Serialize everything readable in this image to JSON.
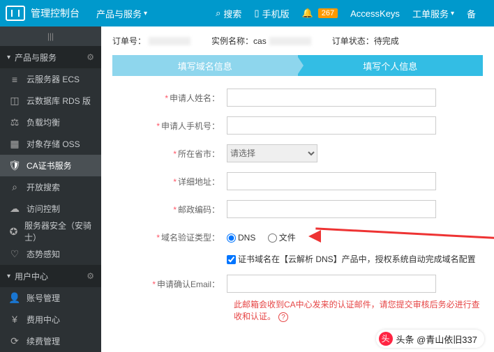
{
  "topbar": {
    "console": "管理控制台",
    "products": "产品与服务",
    "search": "搜索",
    "mobile": "手机版",
    "notif_count": "267",
    "access_keys": "AccessKeys",
    "ticket": "工单服务",
    "backup": "备"
  },
  "sidebar": {
    "section1": "产品与服务",
    "items1": [
      {
        "label": "云服务器 ECS"
      },
      {
        "label": "云数据库 RDS 版"
      },
      {
        "label": "负载均衡"
      },
      {
        "label": "对象存储 OSS"
      },
      {
        "label": "CA证书服务"
      },
      {
        "label": "开放搜索"
      },
      {
        "label": "访问控制"
      },
      {
        "label": "服务器安全（安骑士）"
      },
      {
        "label": "态势感知"
      }
    ],
    "section2": "用户中心",
    "items2": [
      {
        "label": "账号管理"
      },
      {
        "label": "费用中心"
      },
      {
        "label": "续费管理"
      }
    ]
  },
  "order": {
    "num_label": "订单号：",
    "inst_label": "实例名称：cas",
    "status_label": "订单状态：待完成"
  },
  "steps": {
    "s1": "填写域名信息",
    "s2": "填写个人信息"
  },
  "form": {
    "name": "申请人姓名：",
    "phone": "申请人手机号：",
    "province": "所在省市：",
    "province_placeholder": "请选择",
    "address": "详细地址：",
    "postal": "邮政编码：",
    "verify_type": "域名验证类型：",
    "opt_dns": "DNS",
    "opt_file": "文件",
    "cb_text": "证书域名在【云解析 DNS】产品中，授权系统自动完成域名配置",
    "email": "申请确认Email：",
    "note": "此邮箱会收到CA中心发来的认证邮件，请您提交审核后务必进行查收和认证。"
  },
  "watermark": "头条 @青山依旧337"
}
